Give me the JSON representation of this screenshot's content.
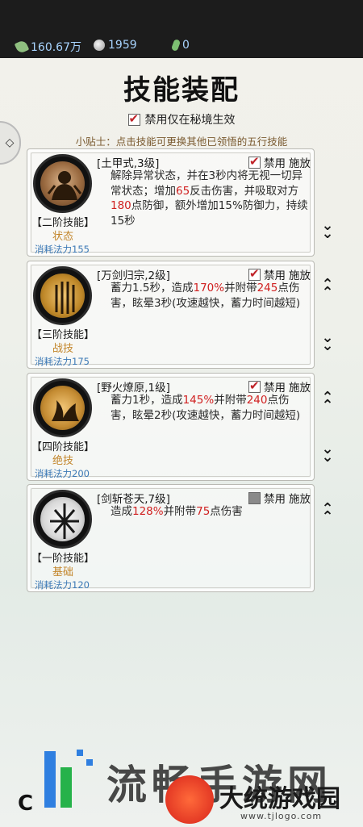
{
  "header": {
    "currency": [
      {
        "icon": "leaf-icon",
        "value": "160.67万"
      },
      {
        "icon": "silver-coin-icon",
        "value": "1959"
      },
      {
        "icon": "jade-icon",
        "value": "0"
      }
    ]
  },
  "title": "技能装配",
  "side_tab_icon": "◇",
  "filter": {
    "label": "禁用仅在秘境生效",
    "checked": true
  },
  "tip": "小贴士：点击技能可更换其他已领悟的五行技能",
  "skills": [
    {
      "name": "[土甲式,3级]",
      "ban_label": "禁用",
      "cast_label": "施放",
      "ban_checked": true,
      "desc_parts": [
        "解除异常状态，并在3秒内将无视一切异常状态；增加",
        "65",
        "反击伤害，并吸取对方",
        "180",
        "点防御，额外增加15%防御力，持续15秒"
      ],
      "tier": "【二阶技能】",
      "kind": "状态",
      "cost": "消耗法力155"
    },
    {
      "name": "[万剑归宗,2级]",
      "ban_label": "禁用",
      "cast_label": "施放",
      "ban_checked": true,
      "desc_parts": [
        "蓄力1.5秒，造成",
        "170%",
        "并附带",
        "245",
        "点伤害，眩晕3秒(攻速越快，蓄力时间越短)"
      ],
      "tier": "【三阶技能】",
      "kind": "战技",
      "cost": "消耗法力175"
    },
    {
      "name": "[野火燎原,1级]",
      "ban_label": "禁用",
      "cast_label": "施放",
      "ban_checked": true,
      "desc_parts": [
        "蓄力1秒，造成",
        "145%",
        "并附带",
        "240",
        "点伤害，眩晕2秒(攻速越快，蓄力时间越短)"
      ],
      "tier": "【四阶技能】",
      "kind": "绝技",
      "cost": "消耗法力200"
    },
    {
      "name": "[剑斩苍天,7级]",
      "ban_label": "禁用",
      "cast_label": "施放",
      "ban_checked": false,
      "desc_parts": [
        "造成",
        "128%",
        "并附带",
        "75",
        "点伤害"
      ],
      "tier": "【一阶技能】",
      "kind": "基础",
      "cost": "消耗法力120"
    }
  ],
  "arrows": {
    "down": "⌄",
    "up": "⌃"
  },
  "watermark": {
    "big": "流畅手游网",
    "site": "大统游戏园",
    "url": "www.tjlogo.com",
    "corner": "C"
  }
}
